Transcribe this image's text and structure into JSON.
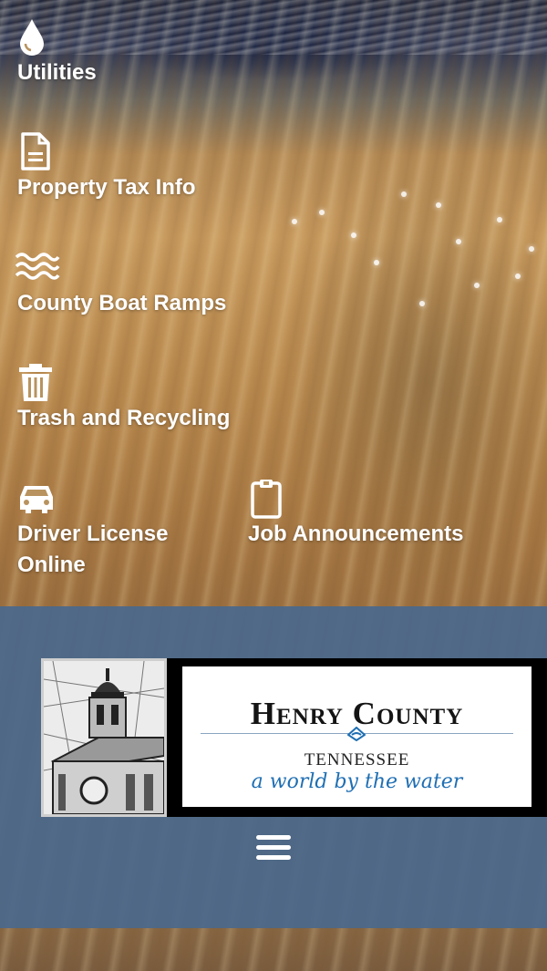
{
  "links": {
    "utilities": {
      "label": "Utilities",
      "icon": "droplet-icon"
    },
    "property_tax": {
      "label": "Property Tax Info",
      "icon": "document-icon"
    },
    "boat_ramps": {
      "label": "County Boat Ramps",
      "icon": "water-waves-icon"
    },
    "trash": {
      "label": "Trash and Recycling",
      "icon": "trash-can-icon"
    },
    "driver_license": {
      "label_line1": "Driver License",
      "label_line2": "Online",
      "icon": "car-icon"
    },
    "jobs": {
      "label": "Job Announcements",
      "icon": "clipboard-icon"
    }
  },
  "footer": {
    "logo": {
      "county": "Henry County",
      "state": "TENNESSEE",
      "tagline": "a world by the water"
    },
    "menu_icon": "hamburger-menu-icon"
  },
  "colors": {
    "footer_bg": "#4a688c",
    "link_text": "#ffffff",
    "tagline": "#1f6fb3"
  }
}
